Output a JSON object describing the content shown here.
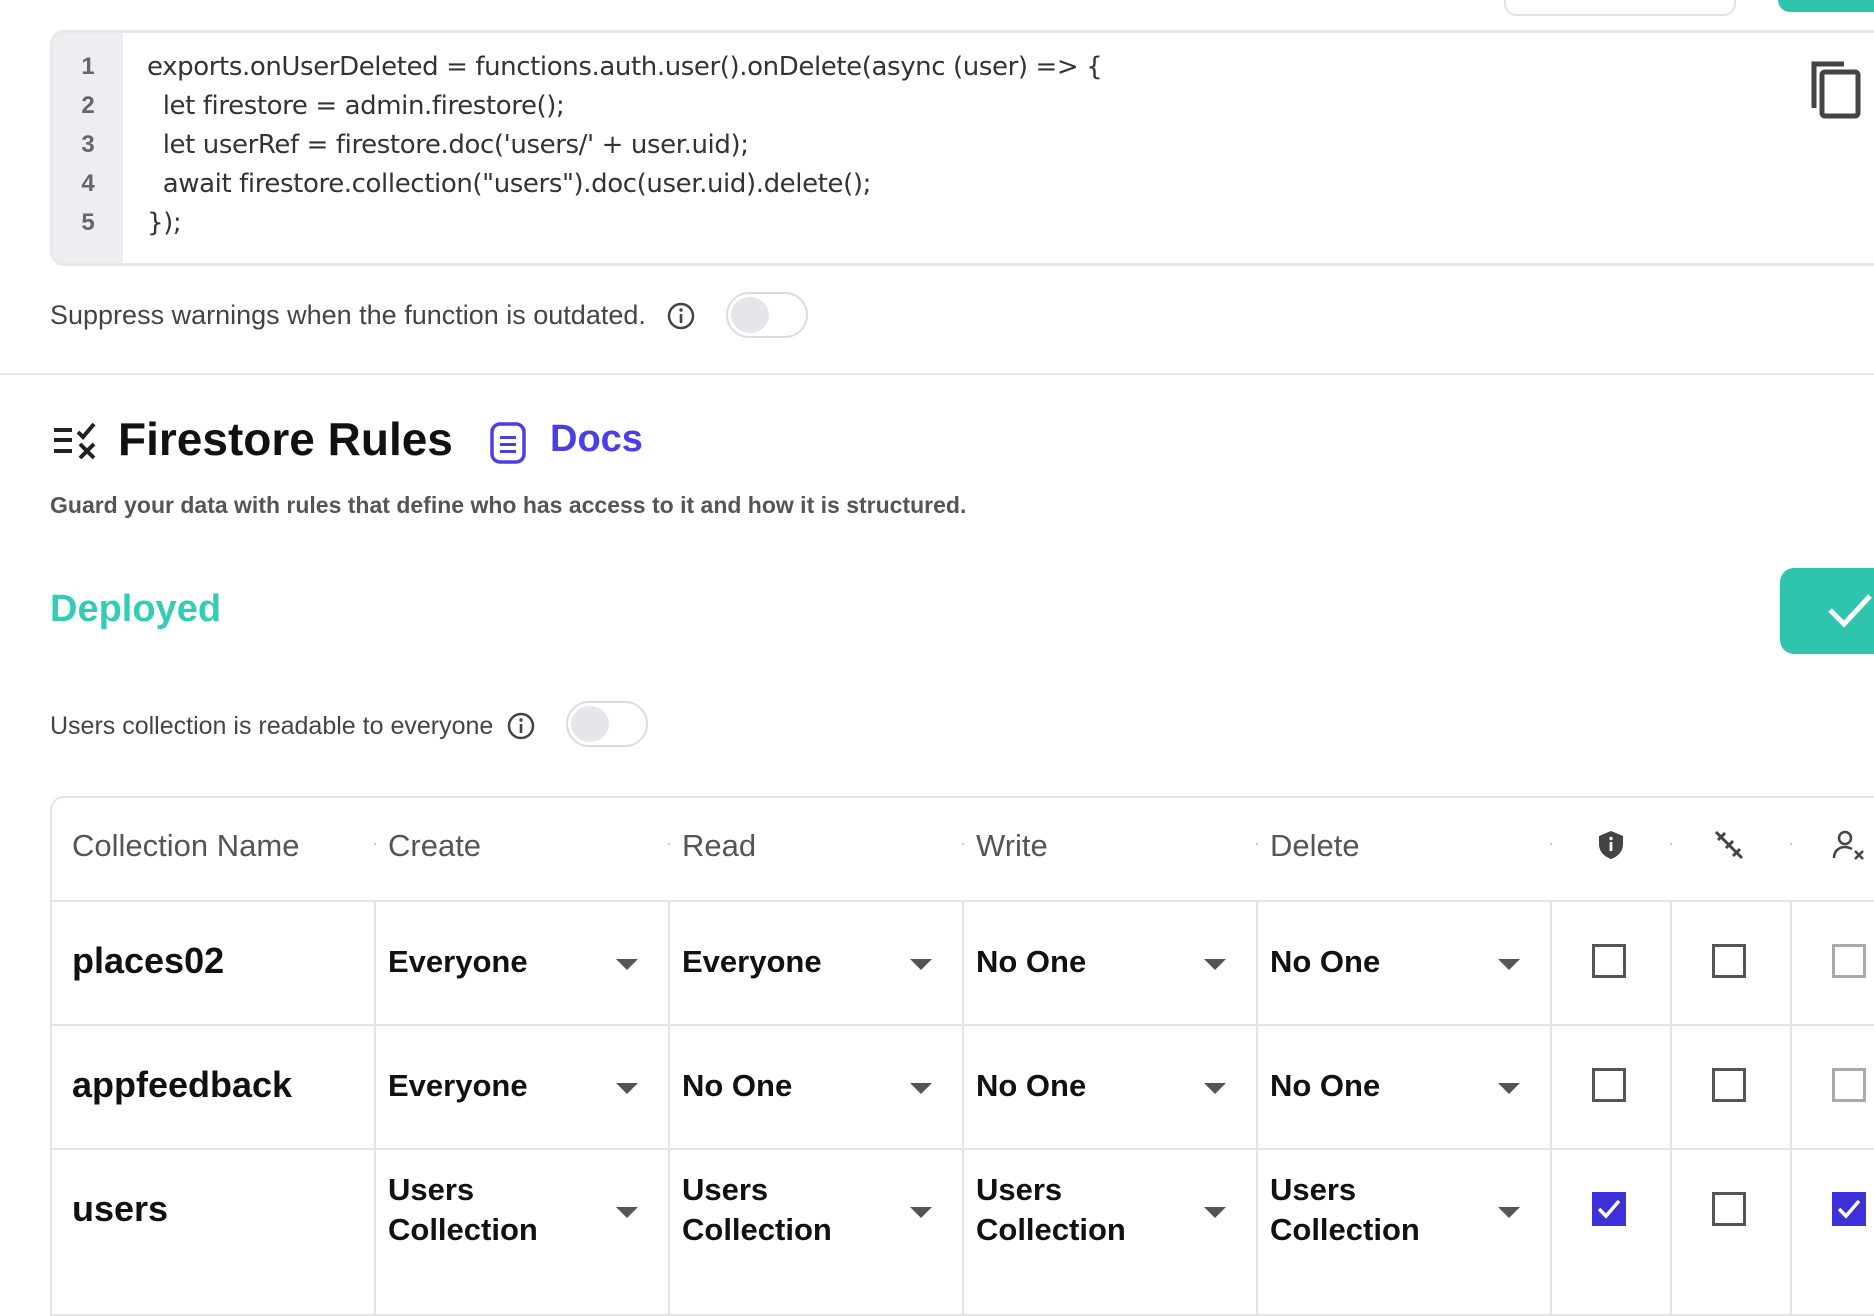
{
  "code_editor": {
    "line_numbers": [
      "1",
      "2",
      "3",
      "4",
      "5"
    ],
    "lines": [
      "exports.onUserDeleted = functions.auth.user().onDelete(async (user) => {",
      "  let firestore = admin.firestore();",
      "  let userRef = firestore.doc('users/' + user.uid);",
      "  await firestore.collection(\"users\").doc(user.uid).delete();",
      "});"
    ],
    "copy_icon": "copy-icon"
  },
  "suppress_warnings": {
    "label": "Suppress warnings when the function is outdated.",
    "enabled": false
  },
  "firestore_rules": {
    "title": "Firestore Rules",
    "docs_label": "Docs",
    "subtitle": "Guard your data with rules that define who has access to it and how it is structured.",
    "status": "Deployed",
    "accent_color": "#33cdb6",
    "link_color": "#4a3ee6"
  },
  "users_readable": {
    "label": "Users collection is readable to everyone",
    "enabled": false
  },
  "table": {
    "headers": {
      "collection": "Collection Name",
      "create": "Create",
      "read": "Read",
      "write": "Write",
      "delete": "Delete",
      "icon1": "shield-icon",
      "icon2": "no-link-icon",
      "icon3": "user-remove-icon"
    },
    "rows": [
      {
        "name": "places02",
        "create": "Everyone",
        "read": "Everyone",
        "write": "No One",
        "delete": "No One",
        "c1": false,
        "c2": false,
        "c3": false
      },
      {
        "name": "appfeedback",
        "create": "Everyone",
        "read": "No One",
        "write": "No One",
        "delete": "No One",
        "c1": false,
        "c2": false,
        "c3": false
      },
      {
        "name": "users",
        "create": "Users Collection",
        "read": "Users Collection",
        "write": "Users Collection",
        "delete": "Users Collection",
        "c1": true,
        "c2": false,
        "c3": true
      }
    ],
    "checkbox_color": "#3d30d9"
  }
}
